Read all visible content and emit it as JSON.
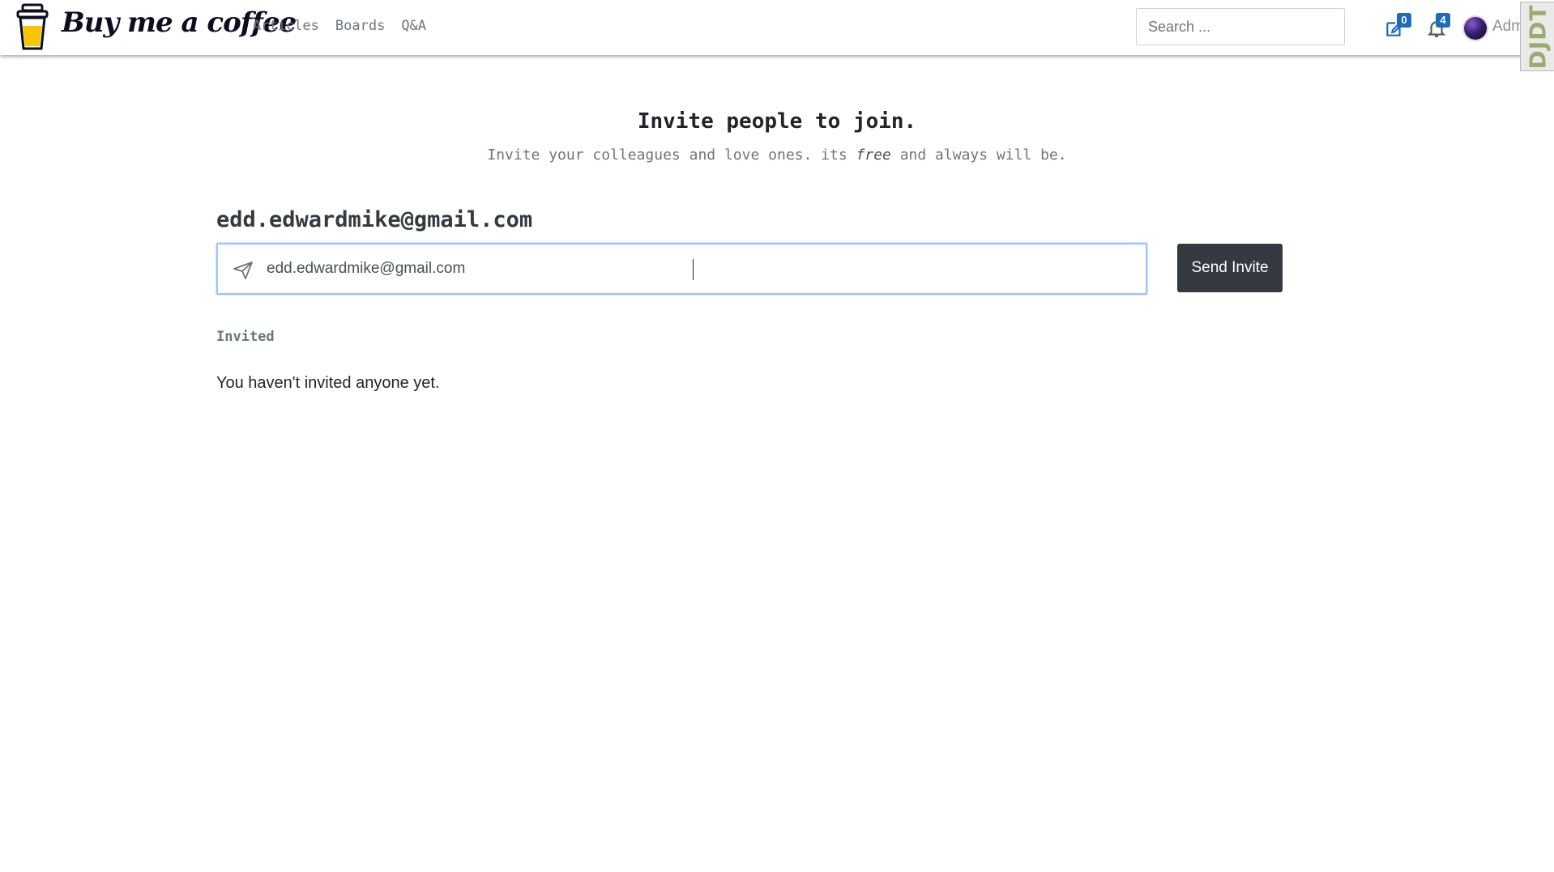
{
  "navbar": {
    "brand": "Buy me a coffee",
    "links": [
      "Articles",
      "Boards",
      "Q&A"
    ],
    "search_placeholder": "Search ...",
    "drafts_badge": "0",
    "notifications_badge": "4",
    "user_name": "Admin",
    "debug_toolbar_label": "DJDT"
  },
  "hero": {
    "title": "Invite people to join.",
    "subtitle_before": "Invite your colleagues and love ones. its ",
    "subtitle_emphasis": "free",
    "subtitle_after": " and always will be."
  },
  "invite": {
    "email_heading": "edd.edwardmike@gmail.com",
    "input_value": "edd.edwardmike@gmail.com",
    "send_button": "Send Invite"
  },
  "invited": {
    "label": "Invited",
    "empty_message": "You haven't invited anyone yet."
  },
  "colors": {
    "badge": "#1e6bb8",
    "button": "#343a40",
    "cup_yellow": "#f7c600"
  },
  "icons": [
    "coffee-cup-icon",
    "edit-icon",
    "bell-icon",
    "send-icon"
  ]
}
